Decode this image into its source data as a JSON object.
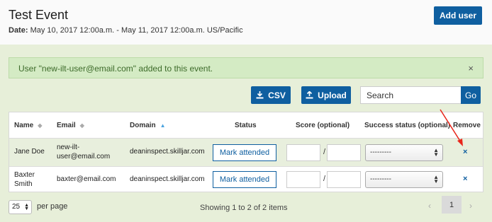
{
  "header": {
    "title": "Test Event",
    "date_label": "Date:",
    "date_value": "May 10, 2017 12:00a.m. - May 11, 2017 12:00a.m. US/Pacific",
    "add_user_label": "Add user"
  },
  "alert": {
    "message": "User \"new-ilt-user@email.com\" added to this event.",
    "close_glyph": "×"
  },
  "toolbar": {
    "csv_label": "CSV",
    "upload_label": "Upload",
    "search_placeholder": "Search",
    "go_label": "Go"
  },
  "table": {
    "columns": {
      "name": "Name",
      "email": "Email",
      "domain": "Domain",
      "status": "Status",
      "score": "Score (optional)",
      "success": "Success status (optional)",
      "remove": "Remove"
    },
    "rows": [
      {
        "name": "Jane Doe",
        "email": "new-ilt-\nuser@email.com",
        "domain": "deaninspect.skilljar.com",
        "status_button": "Mark attended",
        "score_separator": "/",
        "success_value": "---------",
        "remove_glyph": "×"
      },
      {
        "name": "Baxter\nSmith",
        "email": "baxter@email.com",
        "domain": "deaninspect.skilljar.com",
        "status_button": "Mark attended",
        "score_separator": "/",
        "success_value": "---------",
        "remove_glyph": "×"
      }
    ]
  },
  "footer": {
    "per_page_value": "25",
    "per_page_label": "per page",
    "showing_text": "Showing 1 to 2 of 2 items",
    "current_page": "1",
    "prev_glyph": "‹",
    "next_glyph": "›"
  },
  "colors": {
    "primary": "#0f5fa0",
    "page_bg": "#e7efd9",
    "alert_bg": "#d4ebc4",
    "annotation_arrow": "#e8261b"
  }
}
